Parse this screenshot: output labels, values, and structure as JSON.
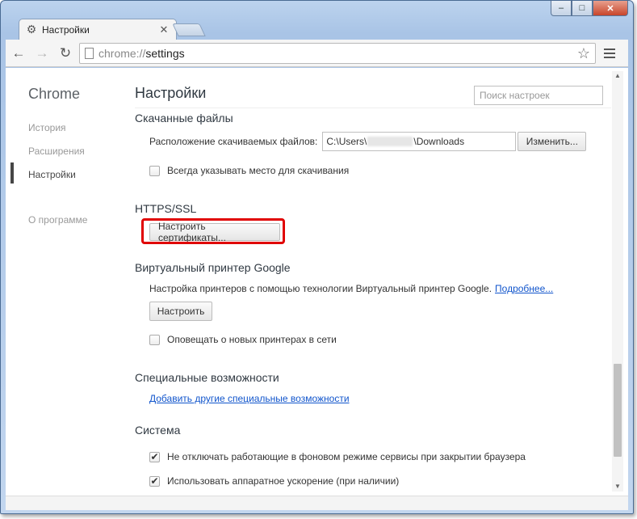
{
  "window": {
    "tab_title": "Настройки",
    "min_label": "‒",
    "max_label": "□",
    "close_label": "✕"
  },
  "toolbar": {
    "url_scheme": "chrome://",
    "url_path": "settings"
  },
  "sidebar": {
    "brand": "Chrome",
    "items": [
      {
        "label": "История"
      },
      {
        "label": "Расширения"
      },
      {
        "label": "Настройки"
      },
      {
        "label": "О программе"
      }
    ]
  },
  "main": {
    "title": "Настройки",
    "search_placeholder": "Поиск настроек",
    "downloads": {
      "title": "Скачанные файлы",
      "location_label": "Расположение скачиваемых файлов:",
      "path_prefix": "C:\\Users\\",
      "path_suffix": "\\Downloads",
      "change_button": "Изменить...",
      "ask_checkbox": "Всегда указывать место для скачивания",
      "ask_checked": false
    },
    "https": {
      "title": "HTTPS/SSL",
      "certs_button": "Настроить сертификаты..."
    },
    "cloudprint": {
      "title": "Виртуальный принтер Google",
      "description": "Настройка принтеров с помощью технологии Виртуальный принтер Google.",
      "more_link": "Подробнее...",
      "setup_button": "Настроить",
      "notify_checkbox": "Оповещать о новых принтерах в сети",
      "notify_checked": false
    },
    "accessibility": {
      "title": "Специальные возможности",
      "add_link": "Добавить другие специальные возможности"
    },
    "system": {
      "title": "Система",
      "background_checkbox": "Не отключать работающие в фоновом режиме сервисы при закрытии браузера",
      "background_checked": true,
      "hw_checkbox": "Использовать аппаратное ускорение (при наличии)",
      "hw_checked": true
    }
  },
  "colors": {
    "highlight": "#e00000",
    "link": "#1155cc"
  }
}
